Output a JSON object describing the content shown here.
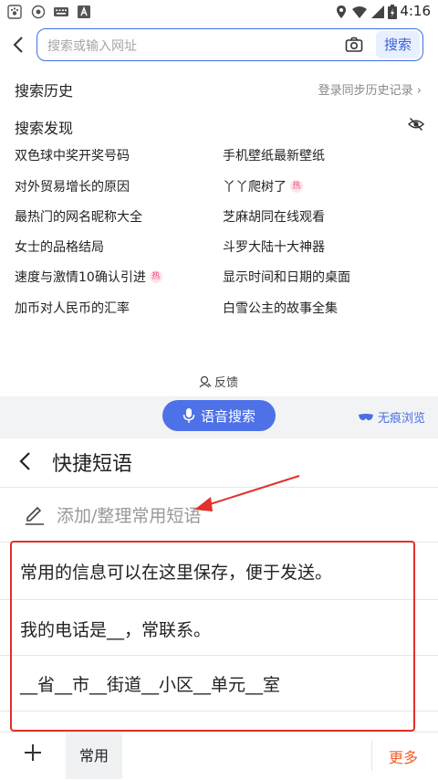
{
  "status_bar": {
    "time": "4:16"
  },
  "search": {
    "placeholder": "搜索或输入网址",
    "button_label": "搜索"
  },
  "history": {
    "title": "搜索历史",
    "sync_link": "登录同步历史记录 ›"
  },
  "discover": {
    "title": "搜索发现",
    "hot_badge": "热",
    "items": [
      {
        "text": "双色球中奖开奖号码",
        "hot": false
      },
      {
        "text": "手机壁纸最新壁纸",
        "hot": false
      },
      {
        "text": "对外贸易增长的原因",
        "hot": false
      },
      {
        "text": "丫丫爬树了",
        "hot": true
      },
      {
        "text": "最热门的网名昵称大全",
        "hot": false
      },
      {
        "text": "芝麻胡同在线观看",
        "hot": false
      },
      {
        "text": "女士的品格结局",
        "hot": false
      },
      {
        "text": "斗罗大陆十大神器",
        "hot": false
      },
      {
        "text": "速度与激情10确认引进",
        "hot": true
      },
      {
        "text": "显示时间和日期的桌面",
        "hot": false
      },
      {
        "text": "加币对人民币的汇率",
        "hot": false
      },
      {
        "text": "白雪公主的故事全集",
        "hot": false
      }
    ],
    "feedback": "反馈"
  },
  "toolbar": {
    "voice_search": "语音搜索",
    "incognito": "无痕浏览"
  },
  "quick_phrases": {
    "title": "快捷短语",
    "add_label": "添加/整理常用短语",
    "phrases": [
      "常用的信息可以在这里保存，便于发送。",
      "我的电话是__，常联系。",
      "__省__市__街道__小区__单元__室"
    ],
    "tab_common": "常用",
    "more": "更多"
  },
  "colors": {
    "accent": "#4e71e8",
    "highlight": "#e0312a",
    "more": "#f0602b"
  }
}
